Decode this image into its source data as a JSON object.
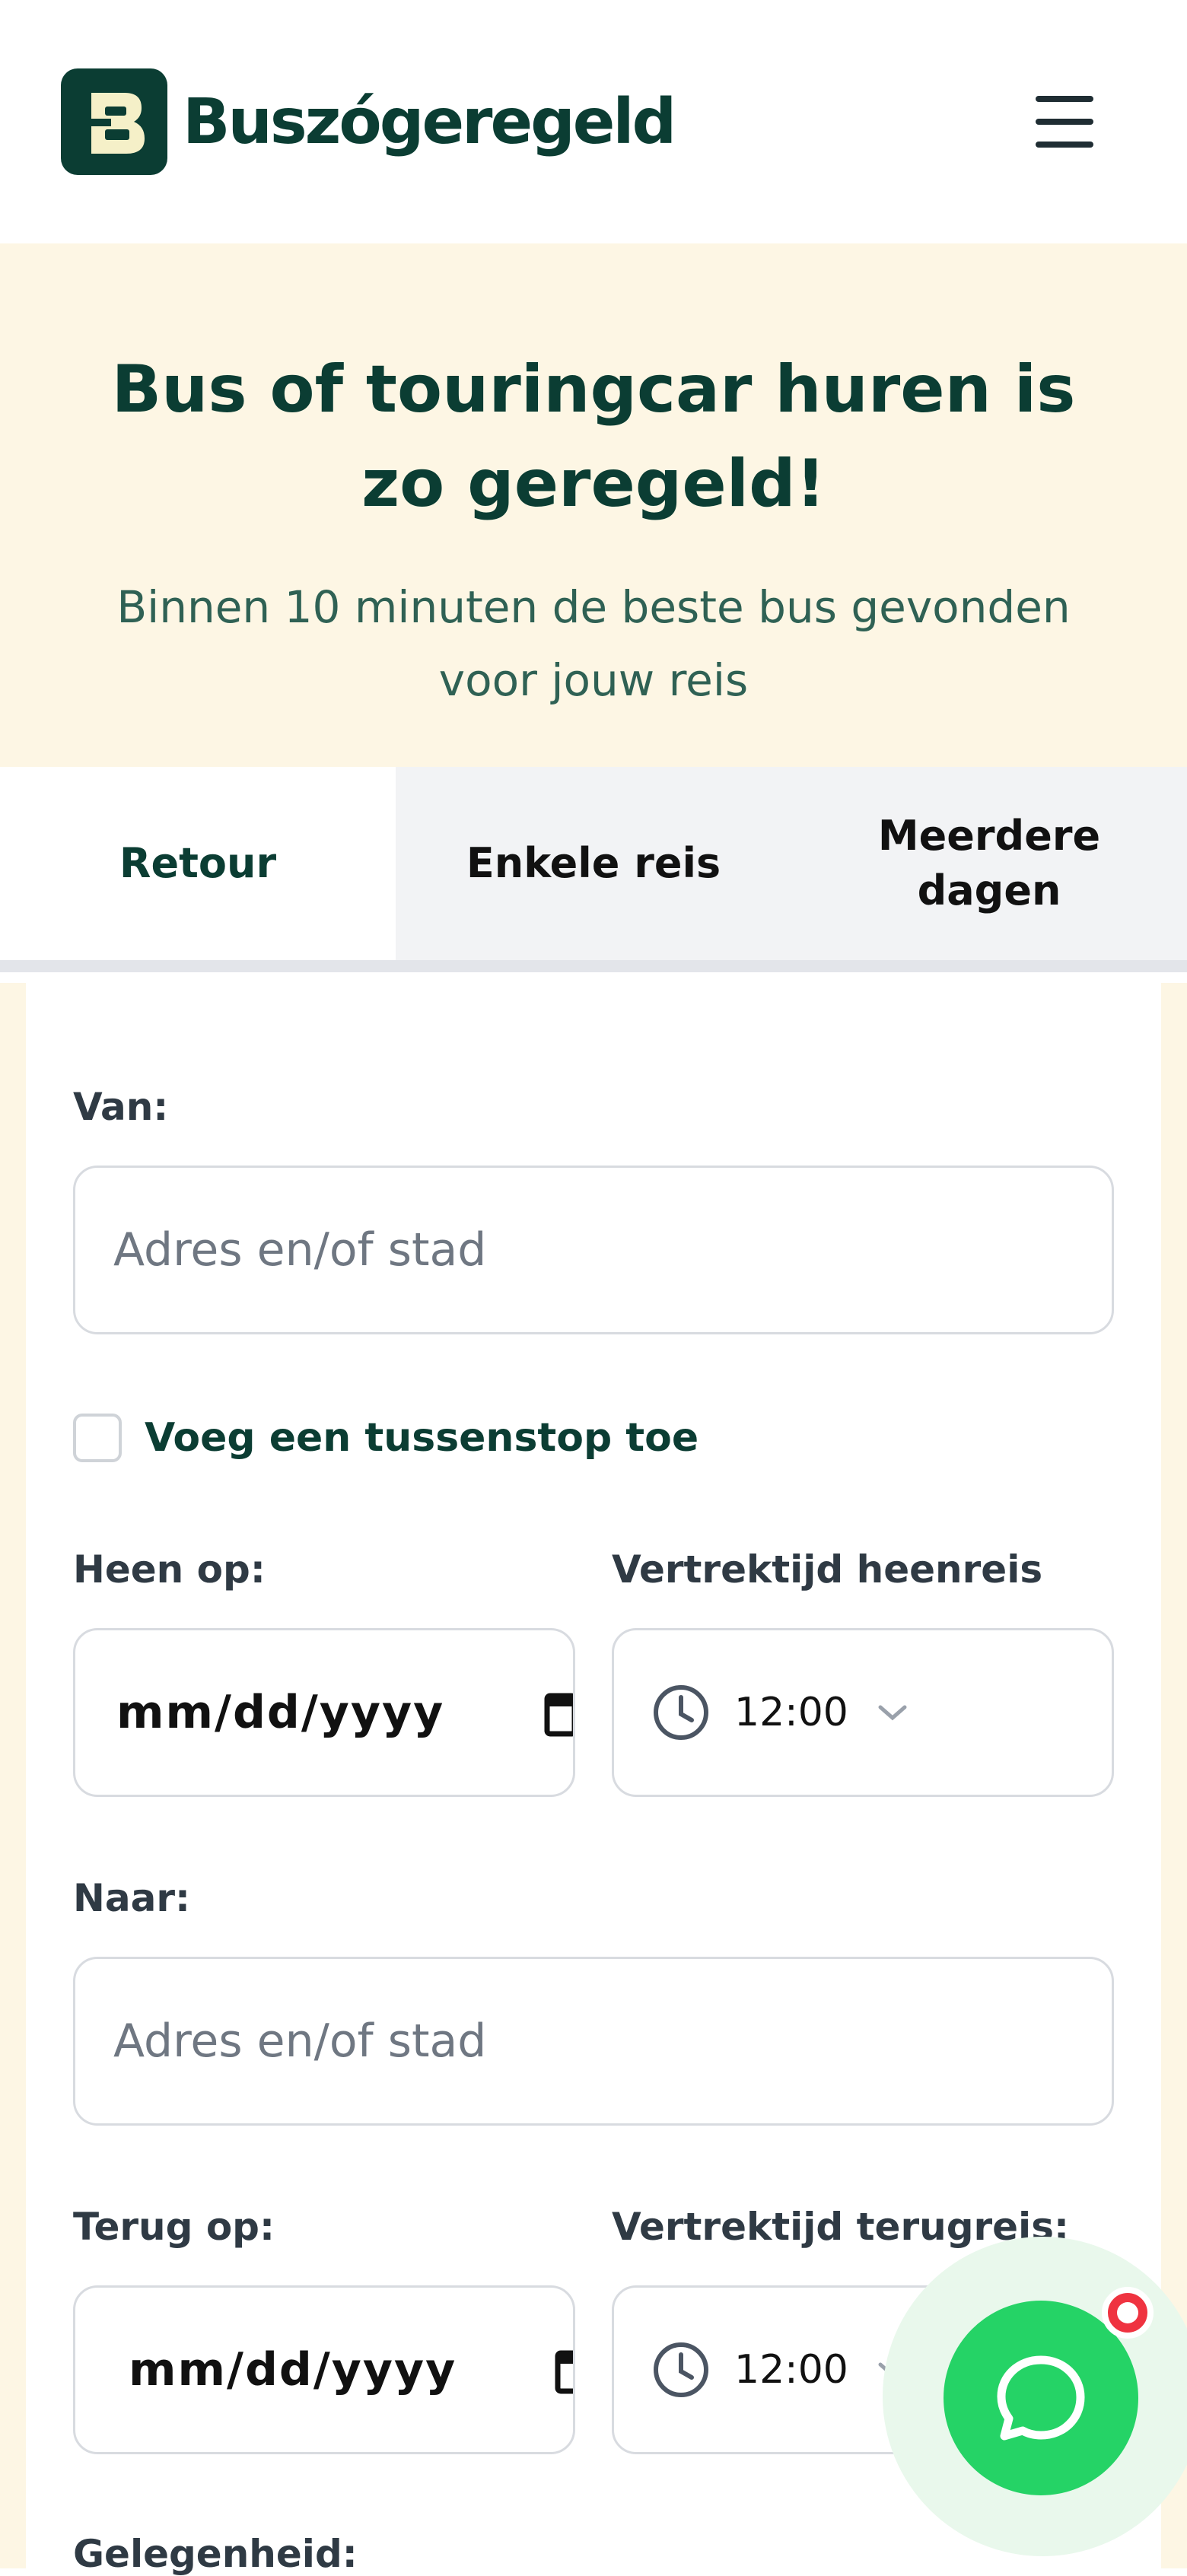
{
  "header": {
    "brand": "Buszógeregeld",
    "icons": {
      "logo": "bus-logo-icon",
      "menu": "hamburger-menu-icon"
    }
  },
  "hero": {
    "title": "Bus of touringcar huren is zo geregeld!",
    "subtitle": "Binnen 10 minuten de beste bus gevonden voor jouw reis"
  },
  "tabs": [
    {
      "label": "Retour",
      "active": true
    },
    {
      "label": "Enkele reis",
      "active": false
    },
    {
      "label": "Meerdere dagen",
      "active": false
    }
  ],
  "form": {
    "from_label": "Van:",
    "from_placeholder": "Adres en/of stad",
    "stopover_label": "Voeg een tussenstop toe",
    "depart_date_label": "Heen op:",
    "depart_date_value": "mm/dd/yyyy",
    "depart_time_label": "Vertrektijd heenreis",
    "depart_time_value": "12:00",
    "to_label": "Naar:",
    "to_placeholder": "Adres en/of stad",
    "return_date_label": "Terug op:",
    "return_date_value": "mm/dd/yyyy",
    "return_time_label": "Vertrektijd terugreis:",
    "return_time_value": "12:00",
    "occasion_label": "Gelegenheid:"
  },
  "colors": {
    "brand": "#0b3d33",
    "hero_bg": "#fdf6e4",
    "chat_green": "#25d366",
    "badge_red": "#ef3340"
  }
}
